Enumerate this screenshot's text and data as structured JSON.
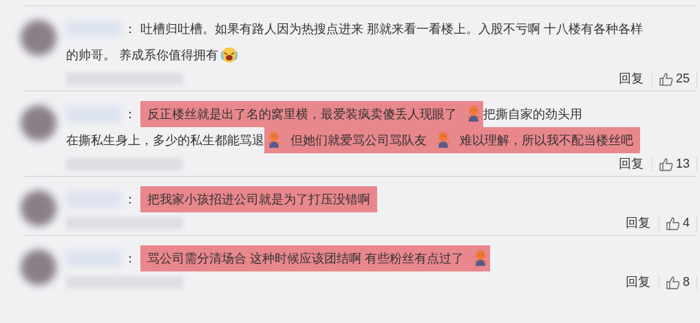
{
  "comments": [
    {
      "lines": [
        [
          {
            "kind": "text",
            "text": "吐槽归吐槽。如果有路人因为热搜点进来 那就来看一看楼上。入股不亏啊 十八楼有各种各样",
            "highlighted": false
          }
        ],
        [
          {
            "kind": "text",
            "text": "的帅哥。 养成系你值得拥有",
            "highlighted": false
          },
          {
            "kind": "laughing",
            "highlighted": false
          }
        ]
      ],
      "reply": "回复",
      "likes": "25"
    },
    {
      "lines": [
        [
          {
            "kind": "text",
            "text": "反正楼丝就是出了名的窝里横，最爱装疯卖傻丢人现眼了",
            "highlighted": true
          },
          {
            "kind": "doll",
            "highlighted": true
          },
          {
            "kind": "text",
            "text": "把撕自家的劲头用",
            "highlighted": false
          }
        ],
        [
          {
            "kind": "text",
            "text": "在撕私生身上，多少的私生都能骂退",
            "highlighted": false
          },
          {
            "kind": "doll",
            "highlighted": true
          },
          {
            "kind": "text",
            "text": "但她们就爱骂公司骂队友",
            "highlighted": true
          },
          {
            "kind": "doll",
            "highlighted": true
          },
          {
            "kind": "text",
            "text": "难以理解，所以我不配当楼丝吧",
            "highlighted": true
          }
        ]
      ],
      "reply": "回复",
      "likes": "13"
    },
    {
      "lines": [
        [
          {
            "kind": "text",
            "text": "把我家小孩招进公司就是为了打压没错啊",
            "highlighted": true
          }
        ]
      ],
      "reply": "回复",
      "likes": "4"
    },
    {
      "lines": [
        [
          {
            "kind": "text",
            "text": "骂公司需分清场合 这种时候应该团结啊 有些粉丝有点过了",
            "highlighted": true
          },
          {
            "kind": "doll",
            "highlighted": true
          }
        ]
      ],
      "reply": "回复",
      "likes": "8"
    }
  ],
  "separator": "："
}
